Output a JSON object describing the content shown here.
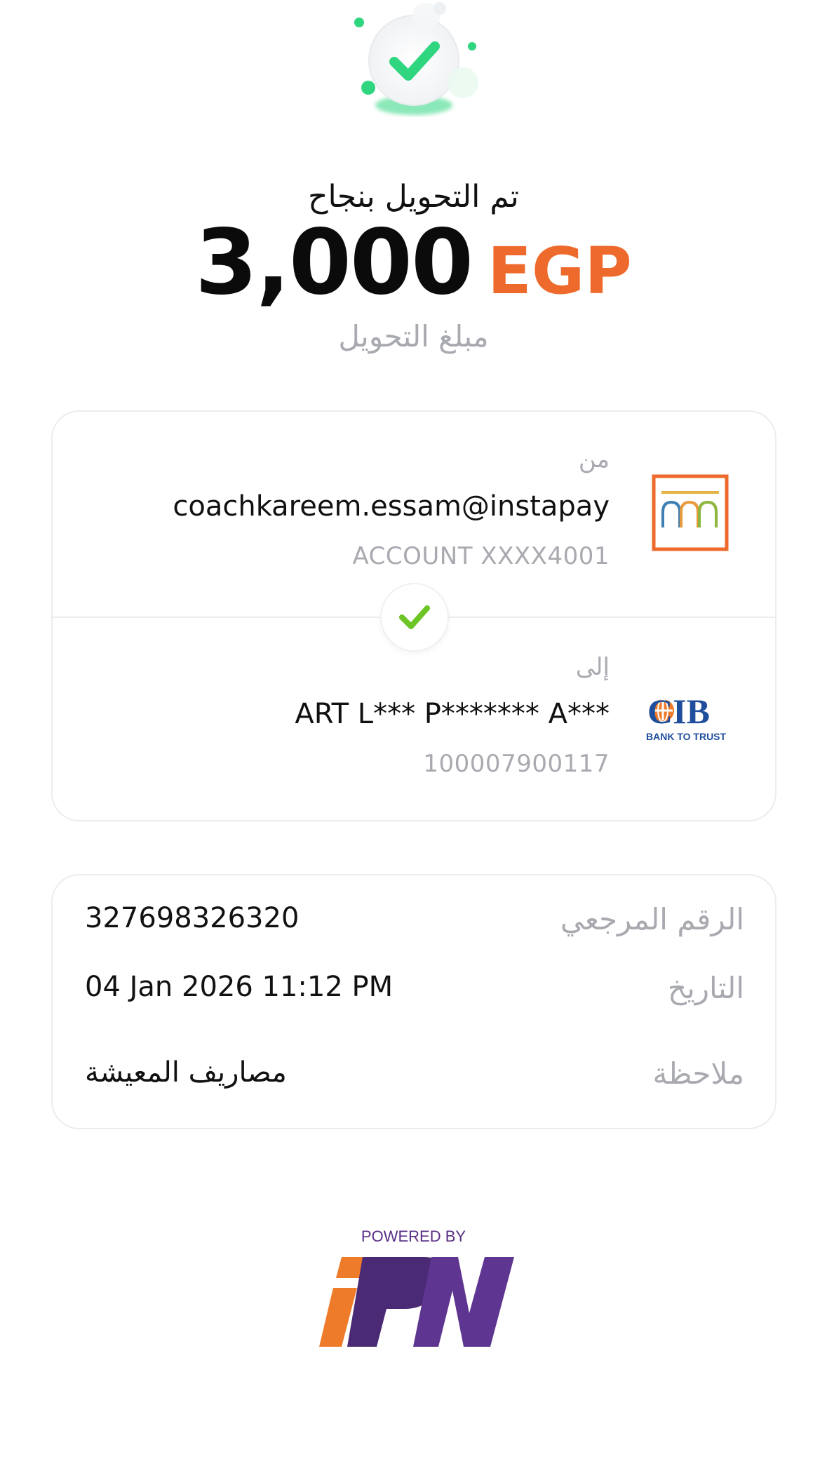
{
  "header": {
    "title": "تم التحويل بنجاح",
    "amount": "3,000",
    "currency": "EGP",
    "subtitle": "مبلغ التحويل"
  },
  "transfer": {
    "from_label": "من",
    "from_name": "coachkareem.essam@instapay",
    "from_account": "ACCOUNT  XXXX4001",
    "to_label": "إلى",
    "to_name": "ART L*** P******* A***",
    "to_account": "100007900117",
    "to_bank_logo_text": "CIB",
    "to_bank_tagline": "BANK TO TRUST"
  },
  "details": {
    "reference_label": "الرقم المرجعي",
    "reference_value": "327698326320",
    "date_label": "التاريخ",
    "date_value": "04 Jan 2026 11:12 PM",
    "note_label": "ملاحظة",
    "note_value": "مصاريف المعيشة"
  },
  "footer": {
    "powered_by": "POWERED BY",
    "logo_text": "IPN"
  },
  "colors": {
    "accent_orange": "#ee6a2c",
    "success_green": "#2fd67f",
    "check_green": "#6cc425",
    "ipn_purple": "#5a2f86"
  },
  "icons": {
    "success": "check-circle-icon",
    "connector": "check-icon"
  }
}
